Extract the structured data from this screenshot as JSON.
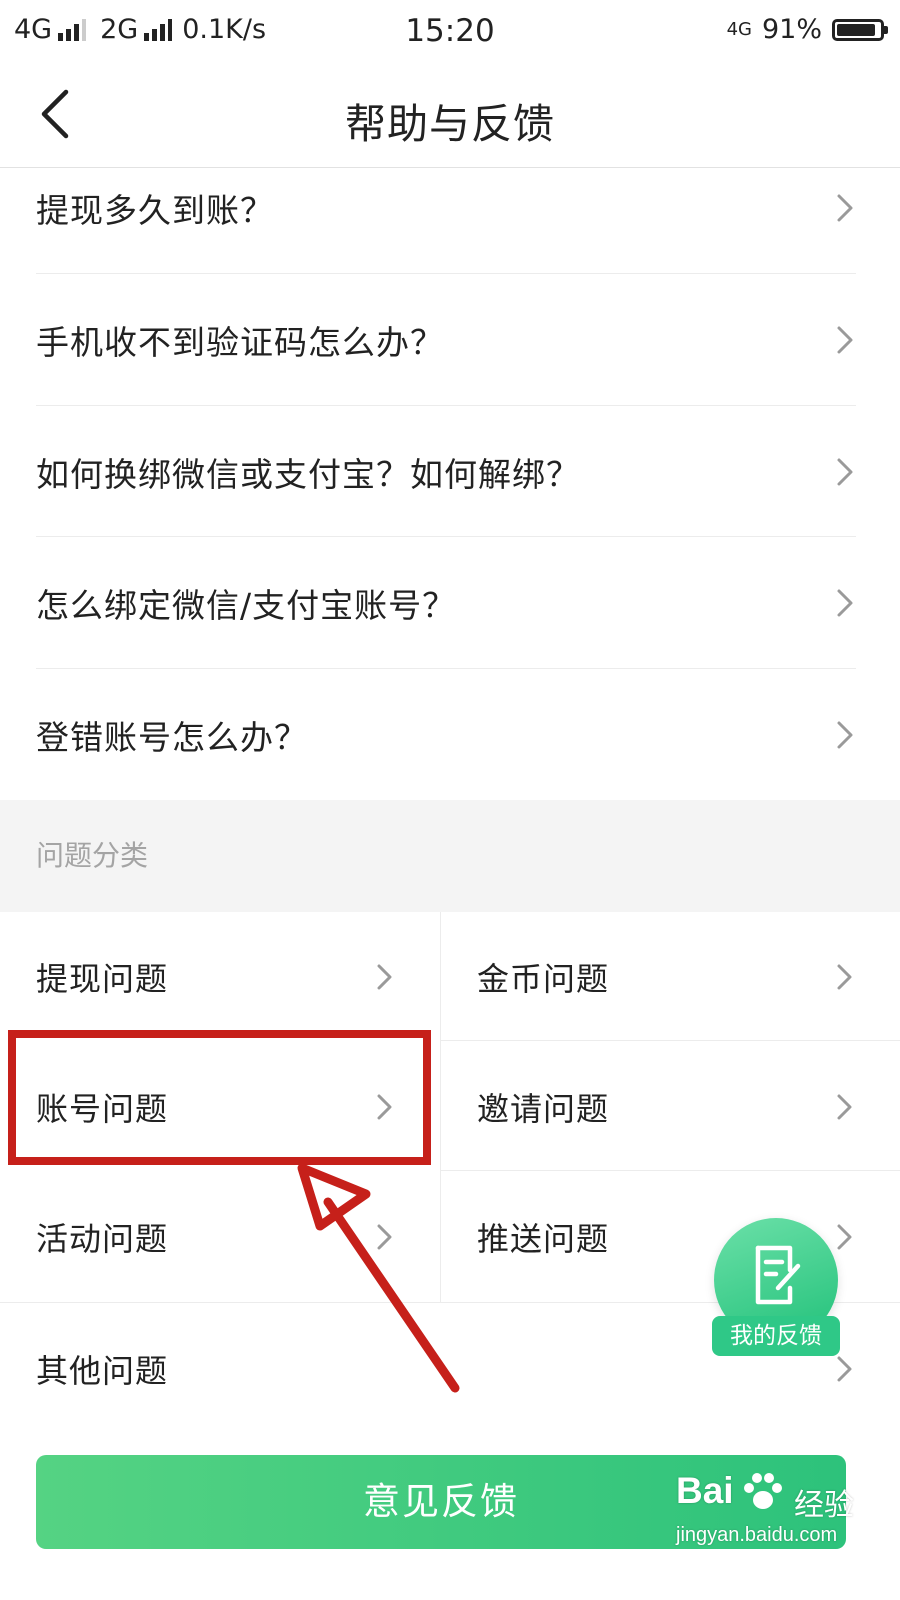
{
  "status_bar": {
    "net1": "4G",
    "net2": "2G",
    "speed": "0.1K/s",
    "time": "15:20",
    "net_right": "4G",
    "battery": "91%",
    "battery_level": 0.91
  },
  "nav": {
    "title": "帮助与反馈"
  },
  "faq": [
    {
      "label": "提现多久到账？"
    },
    {
      "label": "手机收不到验证码怎么办？"
    },
    {
      "label": "如何换绑微信或支付宝？如何解绑？"
    },
    {
      "label": "怎么绑定微信/支付宝账号？"
    },
    {
      "label": "登错账号怎么办？"
    }
  ],
  "categories": {
    "header": "问题分类",
    "items": [
      {
        "label": "提现问题"
      },
      {
        "label": "金币问题"
      },
      {
        "label": "账号问题"
      },
      {
        "label": "邀请问题"
      },
      {
        "label": "活动问题"
      },
      {
        "label": "推送问题"
      },
      {
        "label": "其他问题"
      }
    ]
  },
  "fab": {
    "label": "我的反馈"
  },
  "feedback_button": {
    "label": "意见反馈"
  },
  "watermark": {
    "brand": "Bai",
    "brand_cn": "经验",
    "url": "jingyan.baidu.com"
  },
  "colors": {
    "accent_green": "#2dc27b",
    "highlight_red": "#c6201a"
  }
}
